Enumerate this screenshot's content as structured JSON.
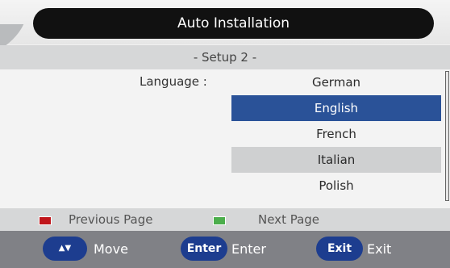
{
  "header": {
    "title": "Auto Installation"
  },
  "subtitle": "- Setup 2 -",
  "language": {
    "label": "Language :",
    "options": [
      "German",
      "English",
      "French",
      "Italian",
      "Polish"
    ],
    "selected_index": 1
  },
  "page_nav": {
    "previous": {
      "label": "Previous Page",
      "color": "#c0151b"
    },
    "next": {
      "label": "Next Page",
      "color": "#4cae4c"
    }
  },
  "keys": [
    {
      "button": "▲▼",
      "label": "Move",
      "icon": "up-down-arrows-icon"
    },
    {
      "button": "Enter",
      "label": "Enter"
    },
    {
      "button": "Exit",
      "label": "Exit"
    }
  ],
  "colors": {
    "accent": "#2a5298",
    "key_button": "#1d3d8f"
  }
}
